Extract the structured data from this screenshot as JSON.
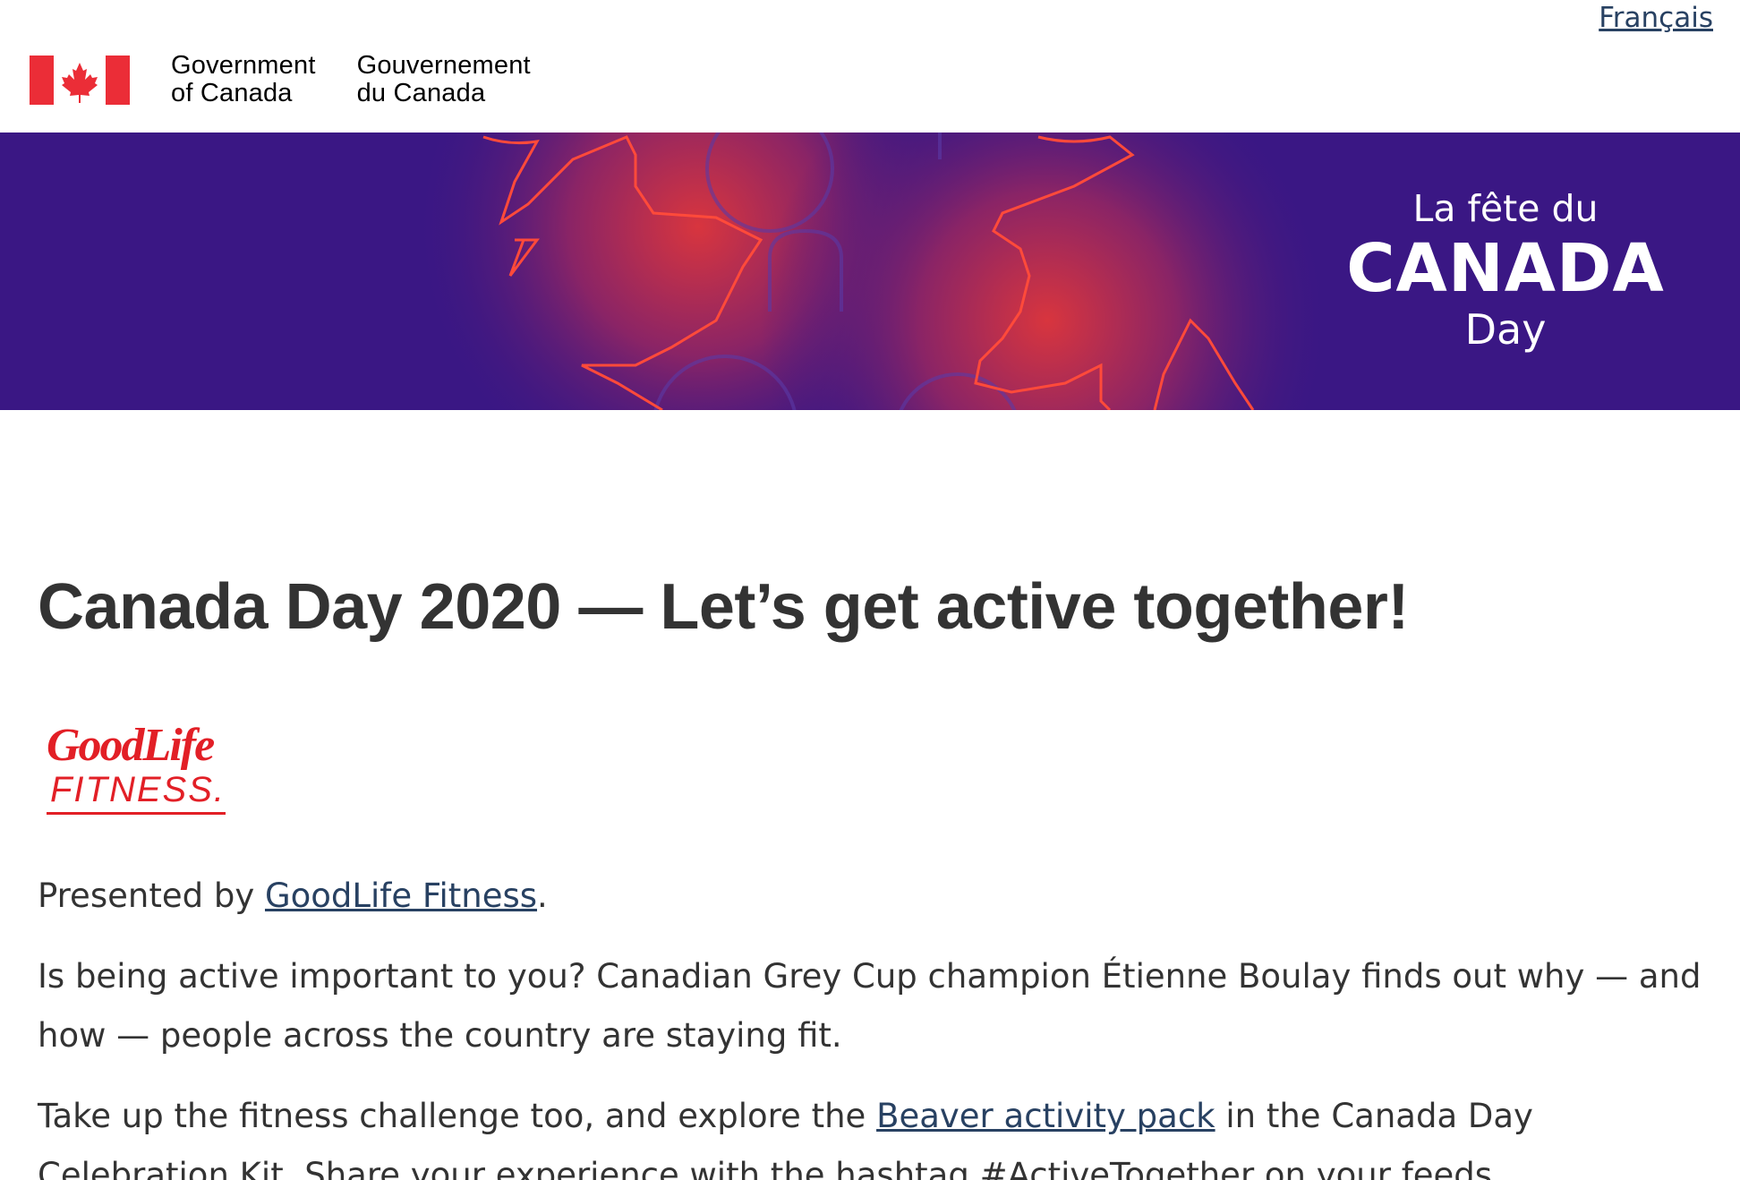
{
  "header": {
    "language_link": "Français",
    "signature_en_line1": "Government",
    "signature_en_line2": "of Canada",
    "signature_fr_line1": "Gouvernement",
    "signature_fr_line2": "du Canada"
  },
  "banner": {
    "line1": "La fête du",
    "line2": "CANADA",
    "line3": "Day"
  },
  "main": {
    "title": "Canada Day 2020 — Let’s get active together!",
    "sponsor_logo": {
      "word1": "GoodLife",
      "word2": "FITNESS."
    },
    "presented_by_prefix": "Presented by ",
    "presented_by_link": "GoodLife Fitness",
    "presented_by_suffix": ".",
    "paragraph2": "Is being active important to you? Canadian Grey Cup champion Étienne Boulay finds out why — and how — people across the country are staying fit.",
    "paragraph3_prefix": "Take up the fitness challenge too, and explore the ",
    "paragraph3_link": "Beaver activity pack",
    "paragraph3_suffix": " in the Canada Day Celebration Kit. Share your experience with the hashtag #ActiveTogether on your feeds."
  },
  "colors": {
    "flag_red": "#eb2d37",
    "link": "#284162",
    "banner_bg": "#3a1784",
    "leaf_red": "#e8453c",
    "logo_red": "#e21f26"
  }
}
